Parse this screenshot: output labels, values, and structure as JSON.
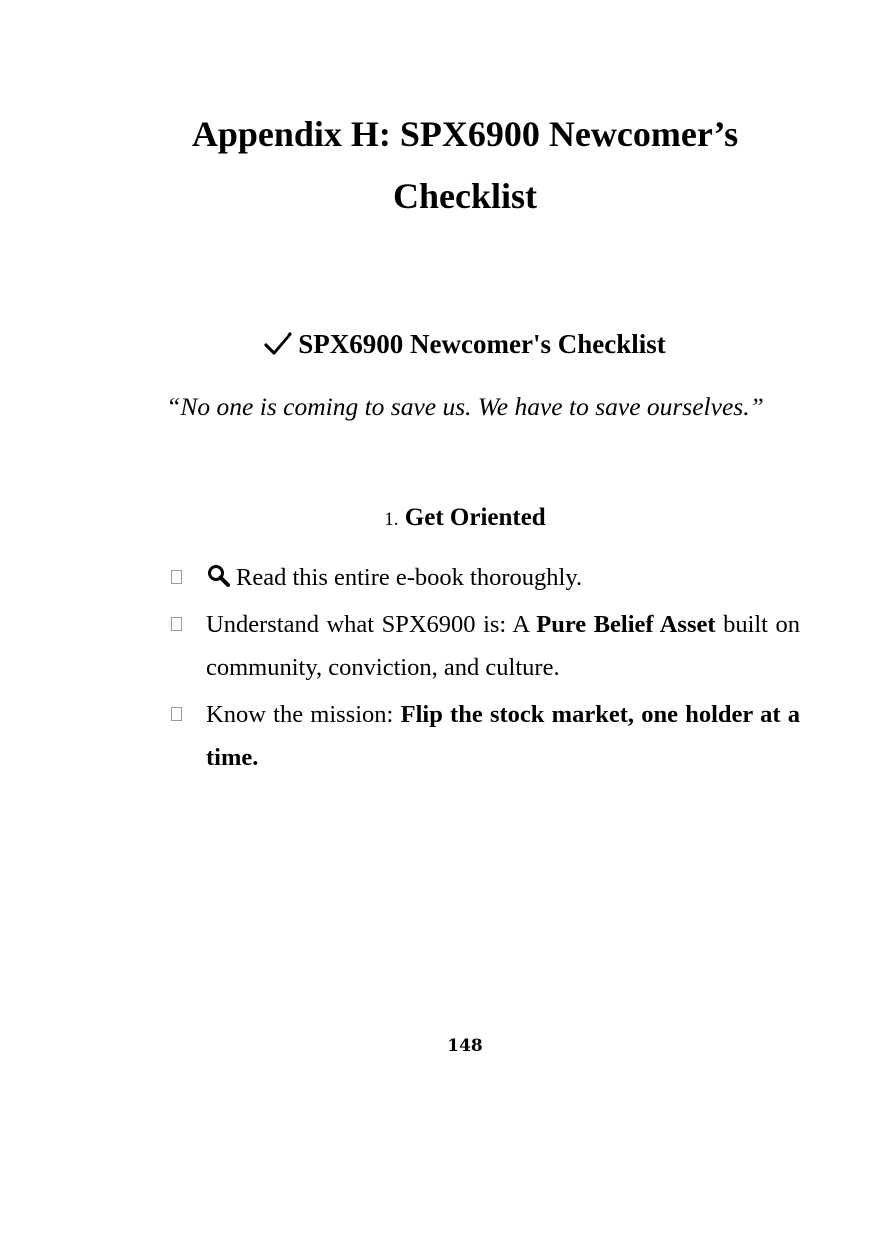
{
  "title": {
    "line1": "Appendix H: SPX6900 Newcomer’s",
    "line2": "Checklist"
  },
  "checklist_heading": {
    "icon": "check-mark-icon",
    "text": "SPX6900 Newcomer's Checklist"
  },
  "quote": "“No one is coming to save us. We have to save ourselves.”",
  "section": {
    "number": "1.",
    "title": "Get Oriented"
  },
  "items": [
    {
      "icon": "magnifying-glass-icon",
      "text": "Read this entire e-book thoroughly."
    },
    {
      "text_before": "Understand what SPX6900 is: A ",
      "bold": "Pure Belief Asset",
      "text_after": " built on community, conviction, and culture."
    },
    {
      "text_before": "Know the mission: ",
      "bold": "Flip the stock market, one holder at a time."
    }
  ],
  "page_number": "148"
}
